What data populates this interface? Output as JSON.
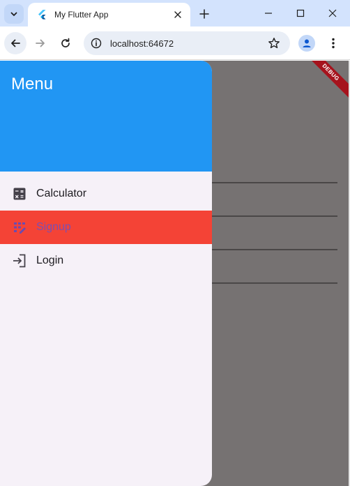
{
  "browser": {
    "tab_title": "My Flutter App",
    "url": "localhost:64672"
  },
  "app": {
    "debug_banner": "DEBUG",
    "drawer": {
      "header_title": "Menu",
      "items": [
        {
          "label": "Calculator",
          "icon": "calculator-icon",
          "selected": false
        },
        {
          "label": "Signup",
          "icon": "signup-icon",
          "selected": true
        },
        {
          "label": "Login",
          "icon": "login-icon",
          "selected": false
        }
      ]
    }
  },
  "colors": {
    "drawer_header": "#2196f3",
    "selected_item_bg": "#f44336",
    "selected_item_text": "#7b4fb3",
    "drawer_bg": "#f6f1f8",
    "scrim": "#767272",
    "debug_banner": "#a6131d"
  }
}
